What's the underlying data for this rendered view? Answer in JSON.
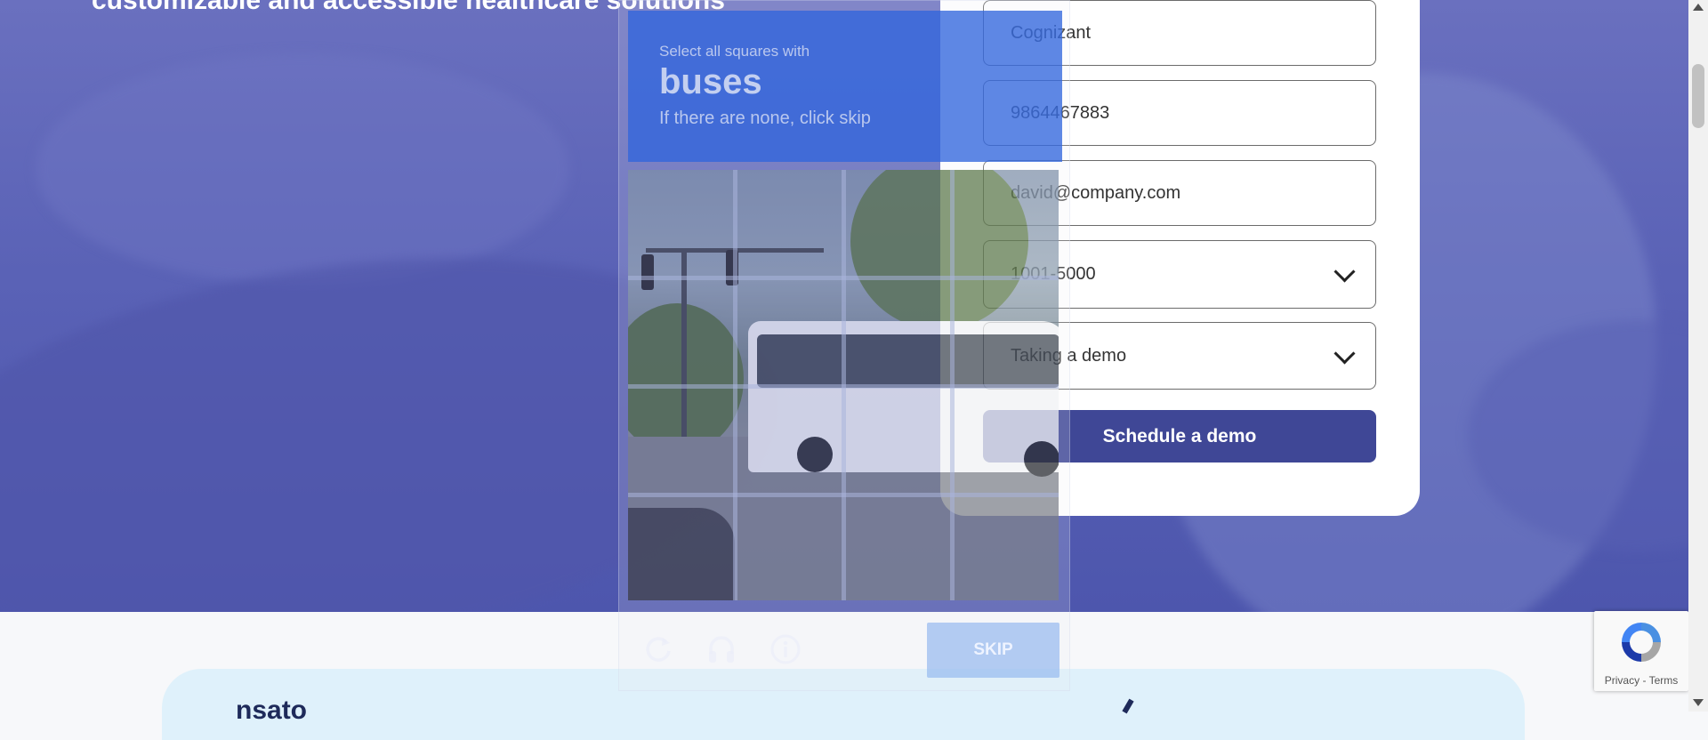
{
  "hero": {
    "heading": "customizable and accessible healthcare solutions"
  },
  "form": {
    "company_value": "Cognizant",
    "phone_value": "9864467883",
    "email_value": "david@company.com",
    "company_size_selected": "1001-5000",
    "interest_selected": "Taking a demo",
    "submit_label": "Schedule a demo"
  },
  "captcha": {
    "instruction_small": "Select all squares with",
    "instruction_target": "buses",
    "instruction_sub": "If there are none, click skip",
    "skip_label": "SKIP",
    "icons": [
      "refresh-icon",
      "headphones-icon",
      "info-icon"
    ],
    "header_color": "#3165dc"
  },
  "bottom": {
    "partial_text": "nsato"
  },
  "recaptcha": {
    "privacy_label": "Privacy",
    "separator": " - ",
    "terms_label": "Terms"
  },
  "colors": {
    "brand": "#3f4796",
    "hero_overlay": "#5a62b6",
    "banner": "#dff1fb"
  }
}
